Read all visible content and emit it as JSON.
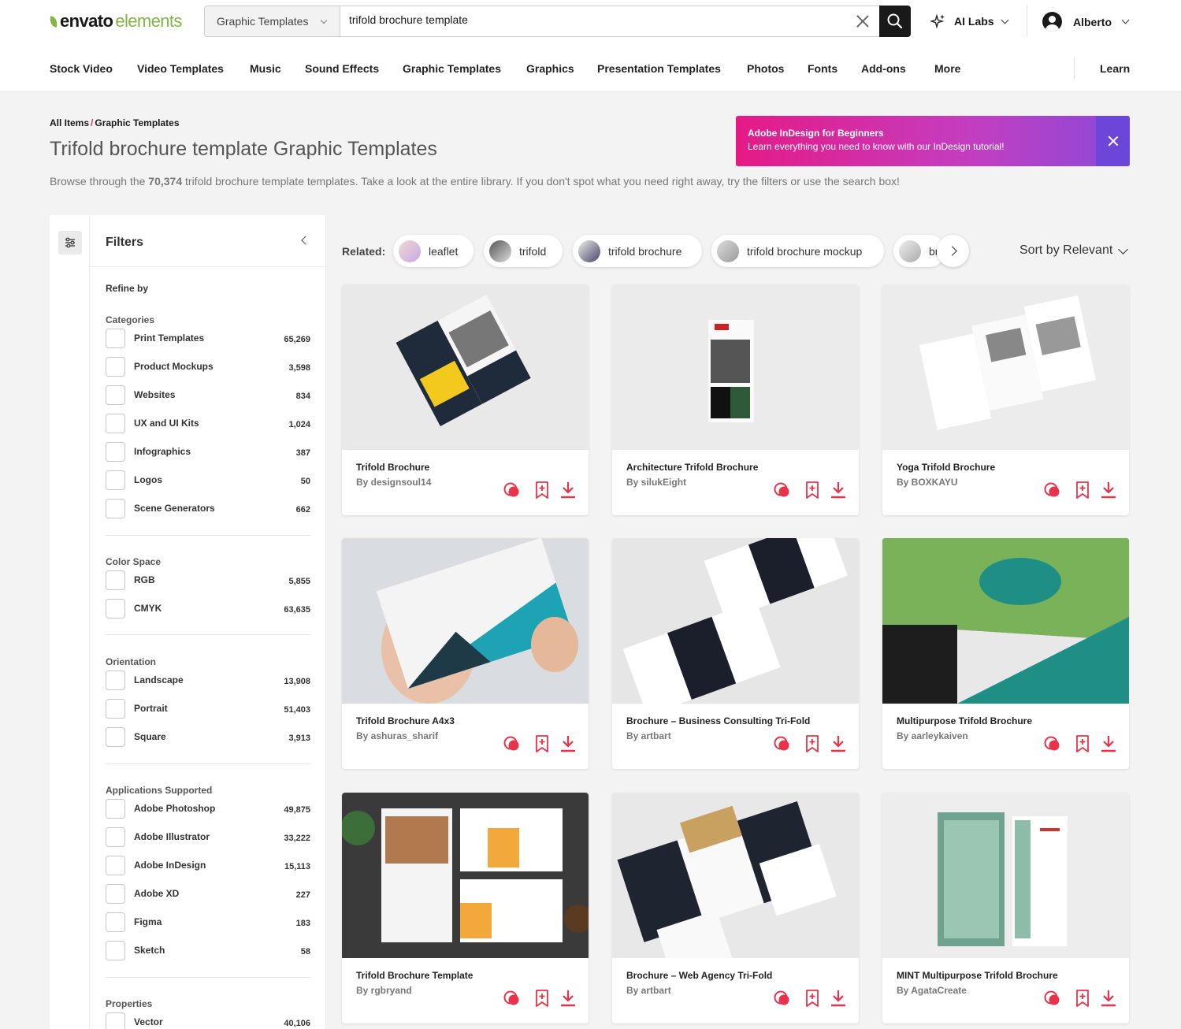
{
  "logo": {
    "part1": "envato",
    "part2": "elements"
  },
  "search": {
    "category": "Graphic Templates",
    "query": "trifold brochure template"
  },
  "header": {
    "ai_labs": "AI Labs",
    "user": "Alberto"
  },
  "nav": [
    "Stock Video",
    "Video Templates",
    "Music",
    "Sound Effects",
    "Graphic Templates",
    "Graphics",
    "Presentation Templates",
    "Photos",
    "Fonts",
    "Add-ons",
    "More",
    "Learn"
  ],
  "breadcrumb": {
    "root": "All Items",
    "sep": "/",
    "current": "Graphic Templates"
  },
  "page": {
    "title": "Trifold brochure template Graphic Templates",
    "desc_pre": "Browse through the ",
    "desc_count": "70,374",
    "desc_post": " trifold brochure template templates. Take a look at the entire library. If you don't spot what you need right away, try the filters or use the search box!"
  },
  "banner": {
    "title": "Adobe InDesign for Beginners",
    "text": "Learn everything you need to know with our InDesign tutorial!"
  },
  "filters": {
    "title": "Filters",
    "refine": "Refine by",
    "sections": [
      {
        "title": "Categories",
        "items": [
          {
            "label": "Print Templates",
            "count": "65,269"
          },
          {
            "label": "Product Mockups",
            "count": "3,598"
          },
          {
            "label": "Websites",
            "count": "834"
          },
          {
            "label": "UX and UI Kits",
            "count": "1,024"
          },
          {
            "label": "Infographics",
            "count": "387"
          },
          {
            "label": "Logos",
            "count": "50"
          },
          {
            "label": "Scene Generators",
            "count": "662"
          }
        ]
      },
      {
        "title": "Color Space",
        "items": [
          {
            "label": "RGB",
            "count": "5,855"
          },
          {
            "label": "CMYK",
            "count": "63,635"
          }
        ]
      },
      {
        "title": "Orientation",
        "items": [
          {
            "label": "Landscape",
            "count": "13,908"
          },
          {
            "label": "Portrait",
            "count": "51,403"
          },
          {
            "label": "Square",
            "count": "3,913"
          }
        ]
      },
      {
        "title": "Applications Supported",
        "items": [
          {
            "label": "Adobe Photoshop",
            "count": "49,875"
          },
          {
            "label": "Adobe Illustrator",
            "count": "33,222"
          },
          {
            "label": "Adobe InDesign",
            "count": "15,113"
          },
          {
            "label": "Adobe XD",
            "count": "227"
          },
          {
            "label": "Figma",
            "count": "183"
          },
          {
            "label": "Sketch",
            "count": "58"
          }
        ]
      },
      {
        "title": "Properties",
        "items": [
          {
            "label": "Vector",
            "count": "40,106"
          }
        ]
      }
    ]
  },
  "related": {
    "label": "Related:",
    "chips": [
      "leaflet",
      "trifold",
      "trifold brochure",
      "trifold brochure mockup",
      "brochure"
    ]
  },
  "sort": "Sort by Relevant",
  "cards": [
    {
      "title": "Trifold Brochure",
      "author": "By designsoul14"
    },
    {
      "title": "Architecture Trifold Brochure",
      "author": "By silukEight"
    },
    {
      "title": "Yoga Trifold Brochure",
      "author": "By BOXKAYU"
    },
    {
      "title": "Trifold Brochure A4x3",
      "author": "By ashuras_sharif"
    },
    {
      "title": "Brochure – Business Consulting Tri-Fold",
      "author": "By artbart"
    },
    {
      "title": "Multipurpose Trifold Brochure",
      "author": "By aarleykaiven"
    },
    {
      "title": "Trifold Brochure Template",
      "author": "By rgbryand"
    },
    {
      "title": "Brochure – Web Agency Tri-Fold",
      "author": "By artbart"
    },
    {
      "title": "MINT Multipurpose Trifold Brochure",
      "author": "By AgataCreate"
    }
  ],
  "colors": {
    "accent": "#e8334a",
    "brand_green": "#82b541",
    "banner_start": "#e51a86",
    "banner_end": "#6b46d9"
  }
}
